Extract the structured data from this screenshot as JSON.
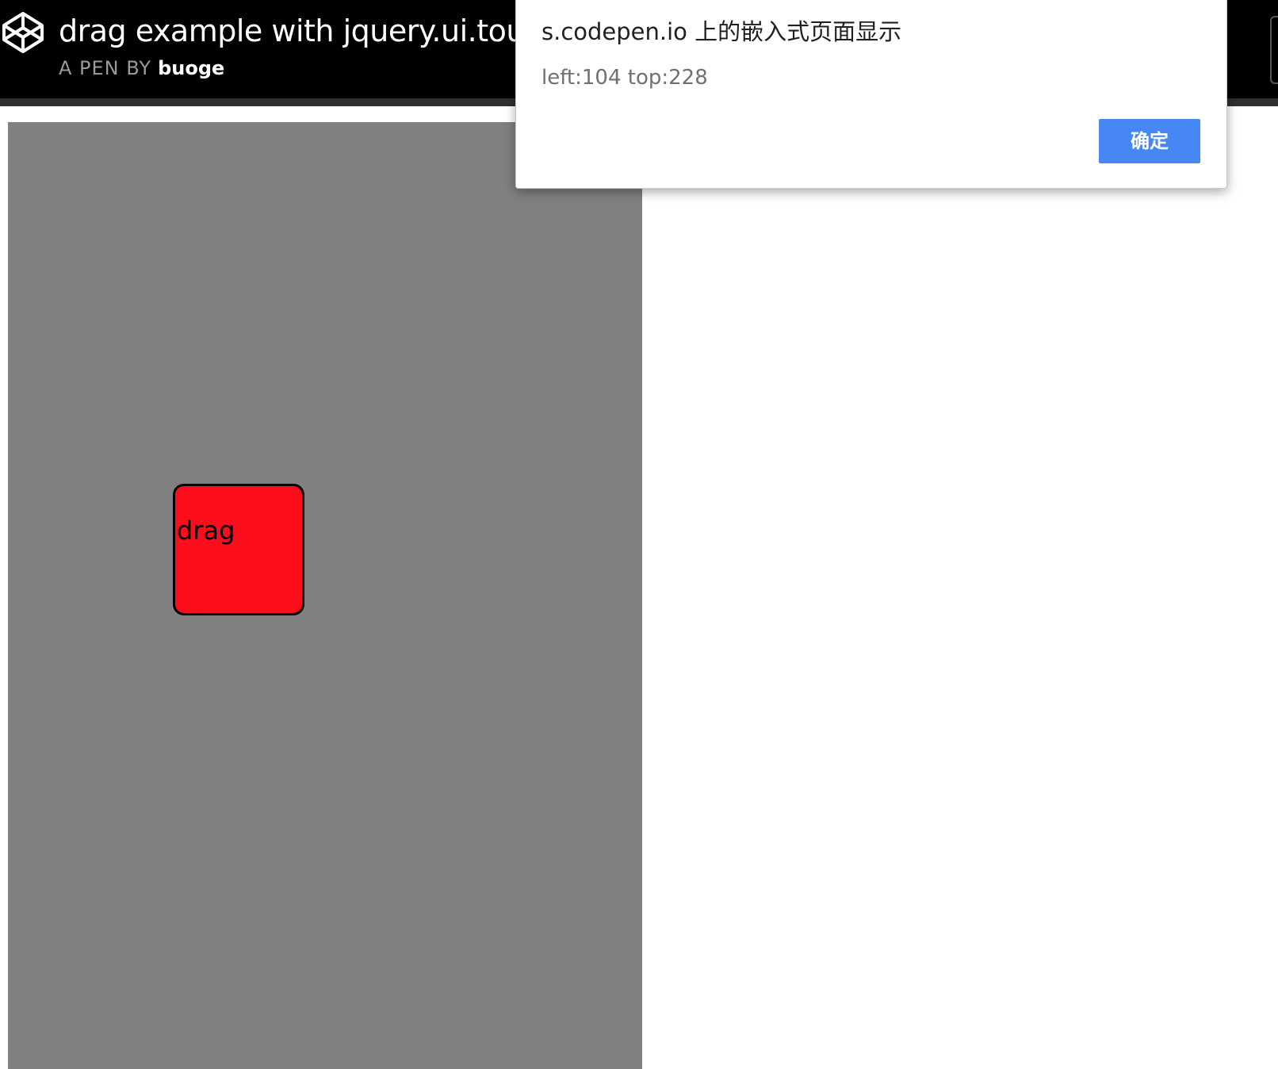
{
  "header": {
    "title": "drag example with jquery.ui.touch-",
    "byline_prefix": "A PEN BY",
    "author": "buoge",
    "logo_icon": "codepen-logo-icon"
  },
  "preview": {
    "draggable_label": "drag",
    "container_color": "#808080",
    "draggable_color": "#fc0d1b"
  },
  "alert": {
    "title": "s.codepen.io 上的嵌入式页面显示",
    "message": "left:104 top:228",
    "ok_label": "确定",
    "button_color": "#4687f4"
  }
}
